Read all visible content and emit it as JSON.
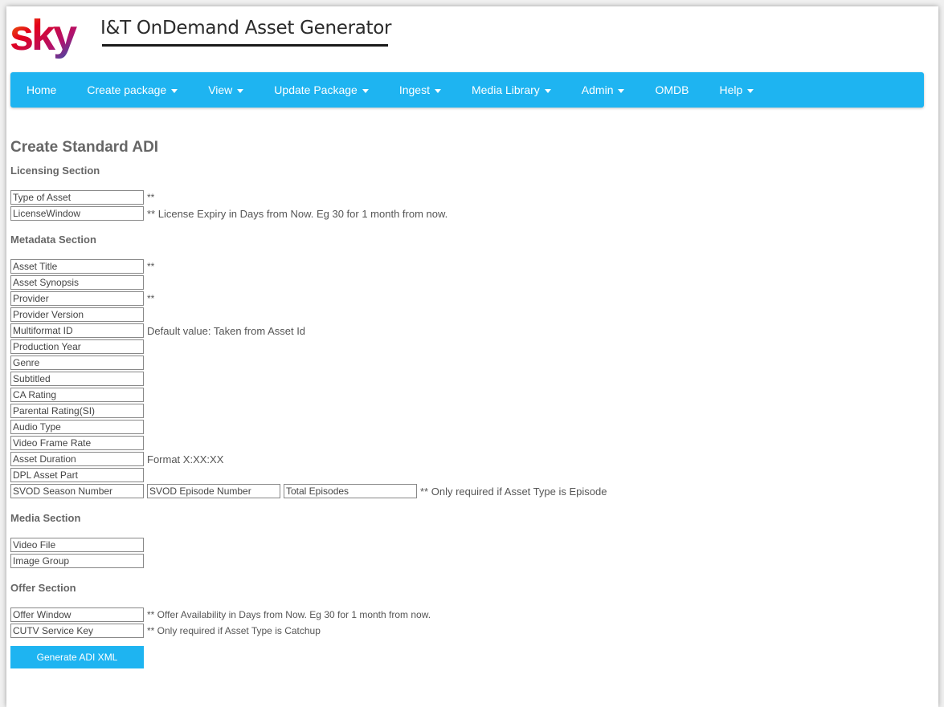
{
  "header": {
    "logo_text": "sky",
    "title": "I&T OnDemand Asset Generator"
  },
  "nav": {
    "items": [
      {
        "label": "Home",
        "dropdown": false
      },
      {
        "label": "Create package",
        "dropdown": true
      },
      {
        "label": "View",
        "dropdown": true
      },
      {
        "label": "Update Package",
        "dropdown": true
      },
      {
        "label": "Ingest",
        "dropdown": true
      },
      {
        "label": "Media Library",
        "dropdown": true
      },
      {
        "label": "Admin",
        "dropdown": true
      },
      {
        "label": "OMDB",
        "dropdown": false
      },
      {
        "label": "Help",
        "dropdown": true
      }
    ]
  },
  "page": {
    "title": "Create Standard ADI"
  },
  "licensing": {
    "title": "Licensing Section",
    "type_of_asset": {
      "placeholder": "Type of Asset",
      "value": "",
      "hint": "**"
    },
    "license_window": {
      "placeholder": "LicenseWindow",
      "value": "",
      "hint": "** License Expiry in Days from Now. Eg 30 for 1 month from now."
    }
  },
  "metadata": {
    "title": "Metadata Section",
    "asset_title": {
      "placeholder": "Asset Title",
      "hint": "**"
    },
    "asset_synopsis": {
      "placeholder": "Asset Synopsis"
    },
    "provider": {
      "placeholder": "Provider",
      "hint": "**"
    },
    "provider_version": {
      "placeholder": "Provider Version"
    },
    "multiformat_id": {
      "placeholder": "Multiformat ID",
      "hint": "Default value: Taken from Asset Id"
    },
    "production_year": {
      "placeholder": "Production Year"
    },
    "genre": {
      "placeholder": "Genre"
    },
    "subtitled": {
      "placeholder": "Subtitled"
    },
    "ca_rating": {
      "placeholder": "CA Rating"
    },
    "parental_rating": {
      "placeholder": "Parental Rating(SI)"
    },
    "audio_type": {
      "placeholder": "Audio Type"
    },
    "video_frame_rate": {
      "placeholder": "Video Frame Rate"
    },
    "asset_duration": {
      "placeholder": "Asset Duration",
      "hint": "Format X:XX:XX"
    },
    "dpl_asset_part": {
      "placeholder": "DPL Asset Part"
    },
    "svod_season_number": {
      "placeholder": "SVOD Season Number"
    },
    "svod_episode_number": {
      "placeholder": "SVOD Episode Number"
    },
    "total_episodes": {
      "placeholder": "Total Episodes"
    },
    "episode_hint": "** Only required if Asset Type is Episode"
  },
  "media": {
    "title": "Media Section",
    "video_file": {
      "placeholder": "Video File"
    },
    "image_group": {
      "placeholder": "Image Group"
    }
  },
  "offer": {
    "title": "Offer Section",
    "offer_window": {
      "placeholder": "Offer Window",
      "hint": "** Offer Availability in Days from Now. Eg 30 for 1 month from now."
    },
    "cutv_service_key": {
      "placeholder": "CUTV Service Key",
      "hint": "** Only required if Asset Type is Catchup"
    }
  },
  "actions": {
    "generate_label": "Generate ADI XML"
  },
  "colors": {
    "nav_bg": "#1eb4f1",
    "logo_red": "#e3001b",
    "logo_blue": "#1d5fb8"
  }
}
